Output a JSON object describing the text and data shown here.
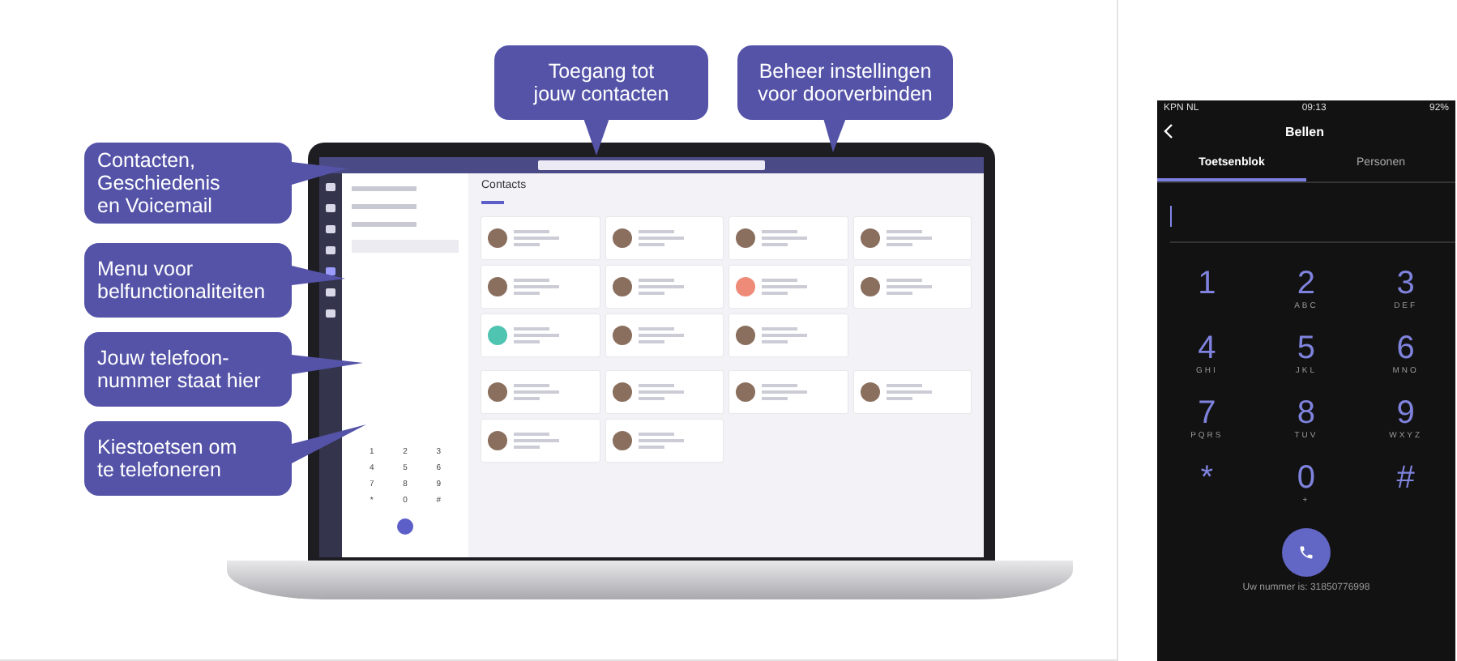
{
  "callouts": [
    {
      "lines": [
        "Contacten,",
        "Geschiedenis",
        "en Voicemail"
      ]
    },
    {
      "lines": [
        "Menu voor",
        "belfunctionaliteiten"
      ]
    },
    {
      "lines": [
        "Jouw telefoon-",
        "nummer staat hier"
      ]
    },
    {
      "lines": [
        "Kiestoetsen om",
        "te telefoneren"
      ]
    },
    {
      "lines": [
        "Toegang tot",
        "jouw contacten"
      ]
    },
    {
      "lines": [
        "Beheer instellingen",
        "voor doorverbinden"
      ]
    }
  ],
  "laptop": {
    "title": "Contacts",
    "dialpad": [
      "1",
      "2",
      "3",
      "4",
      "5",
      "6",
      "7",
      "8",
      "9",
      "*",
      "0",
      "#"
    ],
    "sections": [
      {
        "cards": [
          {
            "kind": "photo"
          },
          {
            "kind": "photo"
          },
          {
            "kind": "photo"
          },
          {
            "kind": "photo"
          },
          {
            "kind": "photo"
          },
          {
            "kind": "photo"
          },
          {
            "kind": "initials",
            "color": "#ee8a78"
          },
          {
            "kind": "photo"
          },
          {
            "kind": "initials",
            "color": "#4fc4b0"
          },
          {
            "kind": "photo"
          },
          {
            "kind": "photo"
          }
        ]
      },
      {
        "cards": [
          {
            "kind": "photo"
          },
          {
            "kind": "photo"
          },
          {
            "kind": "photo"
          },
          {
            "kind": "photo"
          },
          {
            "kind": "photo"
          },
          {
            "kind": "photo"
          }
        ]
      }
    ]
  },
  "phone": {
    "carrier": "KPN NL",
    "time": "09:13",
    "battery": "92%",
    "title": "Bellen",
    "tabs": [
      {
        "label": "Toetsenblok",
        "selected": true
      },
      {
        "label": "Personen",
        "selected": false
      }
    ],
    "keys": [
      {
        "digit": "1"
      },
      {
        "digit": "2",
        "letters": "ABC"
      },
      {
        "digit": "3",
        "letters": "DEF"
      },
      {
        "digit": "4",
        "letters": "GHI"
      },
      {
        "digit": "5",
        "letters": "JKL"
      },
      {
        "digit": "6",
        "letters": "MNO"
      },
      {
        "digit": "7",
        "letters": "PQRS"
      },
      {
        "digit": "8",
        "letters": "TUV"
      },
      {
        "digit": "9",
        "letters": "WXYZ"
      },
      {
        "digit": "*"
      },
      {
        "digit": "0",
        "letters": "+"
      },
      {
        "digit": "#"
      }
    ],
    "number_note": "Uw nummer is: 31850776998"
  }
}
